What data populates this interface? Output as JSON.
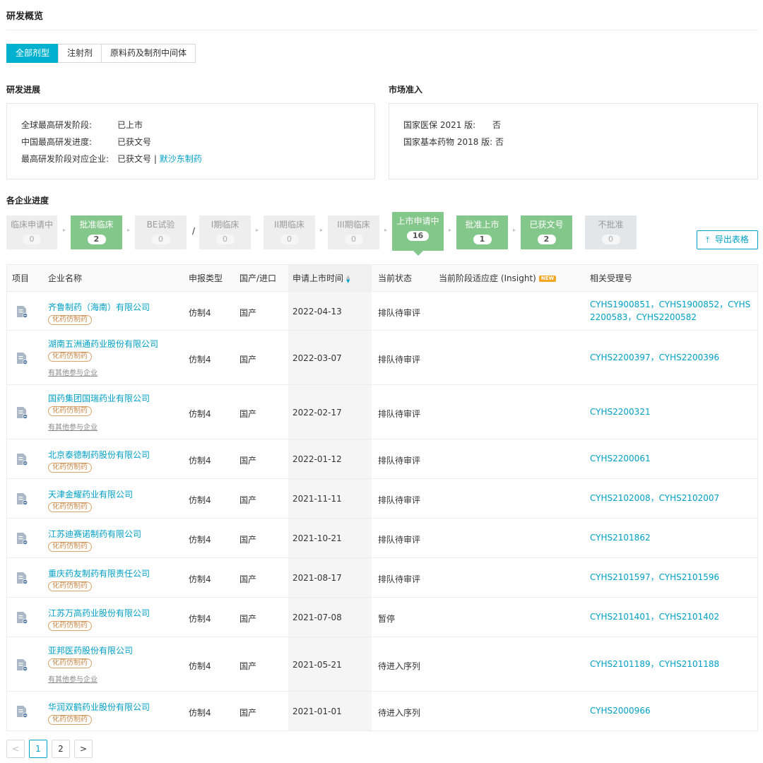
{
  "page": {
    "title": "研发概览"
  },
  "tabs": [
    {
      "label": "全部剂型",
      "active": true
    },
    {
      "label": "注射剂",
      "active": false
    },
    {
      "label": "原料药及制剂中间体",
      "active": false
    }
  ],
  "rd_progress": {
    "title": "研发进展",
    "global_stage_label": "全球最高研发阶段:",
    "global_stage_value": "已上市",
    "china_stage_label": "中国最高研发进度:",
    "china_stage_value": "已获文号",
    "top_company_label": "最高研发阶段对应企业:",
    "top_company_value": "已获文号 |",
    "top_company_link": "默沙东制药"
  },
  "market_access": {
    "title": "市场准入",
    "nrdl_label": "国家医保 2021 版:",
    "nrdl_value": "否",
    "edl_label": "国家基本药物 2018 版:",
    "edl_value": "否"
  },
  "pipeline": {
    "title": "各企业进度",
    "separator": "/",
    "stages": [
      {
        "label": "临床申请中",
        "count": "0",
        "state": "gray"
      },
      {
        "label": "批准临床",
        "count": "2",
        "state": "green"
      },
      {
        "label": "BE试验",
        "count": "0",
        "state": "gray"
      },
      {
        "label": "I期临床",
        "count": "0",
        "state": "gray"
      },
      {
        "label": "II期临床",
        "count": "0",
        "state": "gray"
      },
      {
        "label": "III期临床",
        "count": "0",
        "state": "gray"
      },
      {
        "label": "上市申请中",
        "count": "16",
        "state": "green-active"
      },
      {
        "label": "批准上市",
        "count": "1",
        "state": "green"
      },
      {
        "label": "已获文号",
        "count": "2",
        "state": "green"
      },
      {
        "label": "不批准",
        "count": "0",
        "state": "grayblue"
      }
    ],
    "export_label": "导出表格",
    "export_icon": "upload-icon"
  },
  "colors": {
    "accent": "#00a0c6",
    "tab_active": "#00b0cf",
    "stage_green": "#84c78a",
    "tag_border": "#d9a36a"
  },
  "table": {
    "headers": {
      "item": "项目",
      "company": "企业名称",
      "type": "申报类型",
      "origin": "国产/进口",
      "date": "申请上市时间",
      "status": "当前状态",
      "indication": "当前阶段适应症 (Insight)",
      "new_tag": "NEW",
      "accept": "相关受理号"
    },
    "rows": [
      {
        "company": "齐鲁制药（海南）有限公司",
        "tag": "化药仿制药",
        "more": "",
        "type": "仿制4",
        "origin": "国产",
        "date": "2022-04-13",
        "status": "排队待审评",
        "accept": "CYHS1900851，CYHS1900852，CYHS2200583，CYHS2200582"
      },
      {
        "company": "湖南五洲通药业股份有限公司",
        "tag": "化药仿制药",
        "more": "有其他参与企业",
        "type": "仿制4",
        "origin": "国产",
        "date": "2022-03-07",
        "status": "排队待审评",
        "accept": "CYHS2200397，CYHS2200396"
      },
      {
        "company": "国药集团国瑞药业有限公司",
        "tag": "化药仿制药",
        "more": "有其他参与企业",
        "type": "仿制4",
        "origin": "国产",
        "date": "2022-02-17",
        "status": "排队待审评",
        "accept": "CYHS2200321"
      },
      {
        "company": "北京泰德制药股份有限公司",
        "tag": "化药仿制药",
        "more": "",
        "type": "仿制4",
        "origin": "国产",
        "date": "2022-01-12",
        "status": "排队待审评",
        "accept": "CYHS2200061"
      },
      {
        "company": "天津金耀药业有限公司",
        "tag": "化药仿制药",
        "more": "",
        "type": "仿制4",
        "origin": "国产",
        "date": "2021-11-11",
        "status": "排队待审评",
        "accept": "CYHS2102008，CYHS2102007"
      },
      {
        "company": "江苏迪赛诺制药有限公司",
        "tag": "化药仿制药",
        "more": "",
        "type": "仿制4",
        "origin": "国产",
        "date": "2021-10-21",
        "status": "排队待审评",
        "accept": "CYHS2101862"
      },
      {
        "company": "重庆药友制药有限责任公司",
        "tag": "化药仿制药",
        "more": "",
        "type": "仿制4",
        "origin": "国产",
        "date": "2021-08-17",
        "status": "排队待审评",
        "accept": "CYHS2101597，CYHS2101596"
      },
      {
        "company": "江苏万高药业股份有限公司",
        "tag": "化药仿制药",
        "more": "",
        "type": "仿制4",
        "origin": "国产",
        "date": "2021-07-08",
        "status": "暂停",
        "accept": "CYHS2101401，CYHS2101402"
      },
      {
        "company": "亚邦医药股份有限公司",
        "tag": "化药仿制药",
        "more": "有其他参与企业",
        "type": "仿制4",
        "origin": "国产",
        "date": "2021-05-21",
        "status": "待进入序列",
        "accept": "CYHS2101189，CYHS2101188"
      },
      {
        "company": "华润双鹤药业股份有限公司",
        "tag": "化药仿制药",
        "more": "",
        "type": "仿制4",
        "origin": "国产",
        "date": "2021-01-01",
        "status": "待进入序列",
        "accept": "CYHS2000966"
      }
    ]
  },
  "pagination": {
    "prev": "<",
    "pages": [
      "1",
      "2"
    ],
    "current": "1",
    "next": ">"
  }
}
